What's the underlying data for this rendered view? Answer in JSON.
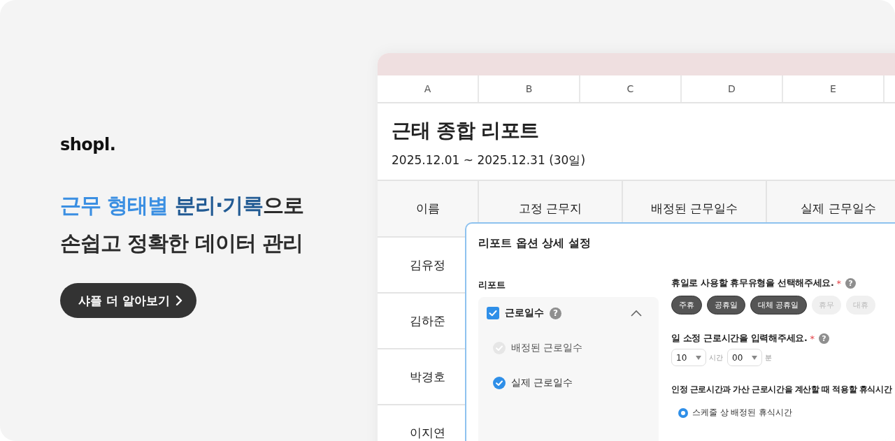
{
  "brand": {
    "logo": "shopl."
  },
  "headline": {
    "lines": [
      {
        "segments": [
          {
            "text": "근무 형태별 ",
            "color": "#3b8fe2"
          },
          {
            "text": "분리·기록",
            "color": "#215a93"
          },
          {
            "text": "으로",
            "color": "#2b2b2b"
          }
        ]
      },
      {
        "segments": [
          {
            "text": "손쉽고 정확한 데이터 관리",
            "color": "#2b2b2b"
          }
        ]
      }
    ]
  },
  "cta": {
    "label": "샤플 더 알아보기"
  },
  "sheet": {
    "column_letters": [
      "A",
      "B",
      "C",
      "D",
      "E"
    ],
    "title": "근태 종합 리포트",
    "period": "2025.12.01 ~ 2025.12.31 (30일)",
    "columns": [
      "이름",
      "고정 근무지",
      "배정된 근무일수",
      "실제 근무일수"
    ],
    "rows": [
      {
        "name": "김유정"
      },
      {
        "name": "김하준"
      },
      {
        "name": "박경호"
      },
      {
        "name": "이지연"
      }
    ]
  },
  "dialog": {
    "title": "리포트 옵션 상세 설정",
    "report_label": "리포트",
    "report_group": {
      "label": "근로일수",
      "checked": true,
      "expanded": true,
      "help_icon": "?",
      "children": [
        {
          "label": "배정된 근로일수",
          "checked": true,
          "disabled": true
        },
        {
          "label": "실제 근로일수",
          "checked": true,
          "disabled": false
        }
      ]
    },
    "questions": [
      {
        "kind": "chips",
        "label": "휴일로 사용할 휴무유형을 선택해주세요.",
        "required_mark": "*",
        "help_icon": "?",
        "options": [
          {
            "label": "주휴",
            "selected": true
          },
          {
            "label": "공휴일",
            "selected": true
          },
          {
            "label": "대체 공휴일",
            "selected": true
          },
          {
            "label": "휴무",
            "selected": false
          },
          {
            "label": "대휴",
            "selected": false
          }
        ]
      },
      {
        "kind": "time",
        "label": "일 소정 근로시간을 입력해주세요.",
        "required_mark": "*",
        "help_icon": "?",
        "hours": "10",
        "hours_unit": "시간",
        "minutes": "00",
        "minutes_unit": "분"
      },
      {
        "kind": "radio",
        "label": "인정 근로시간과 가산 근로시간을 계산할 때 적용할 휴식시간",
        "options": [
          {
            "label": "스케줄 상 배정된 휴식시간",
            "selected": true
          }
        ]
      }
    ]
  }
}
